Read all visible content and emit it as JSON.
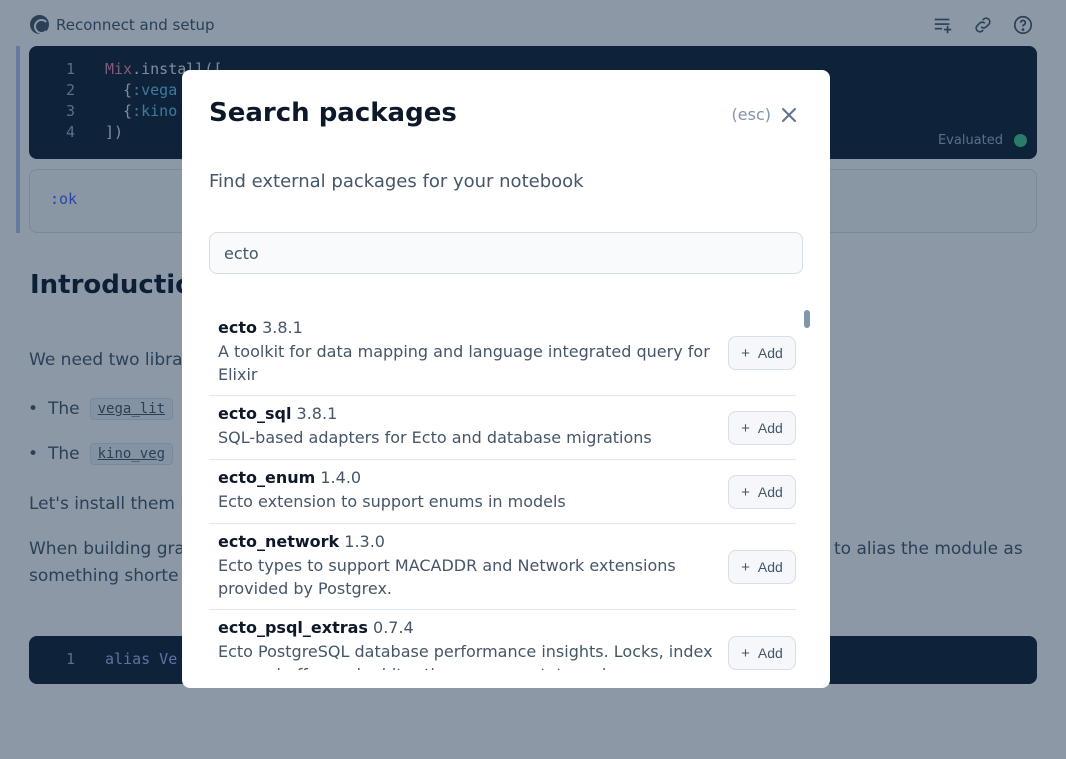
{
  "topbar": {
    "reconnect_label": "Reconnect and setup"
  },
  "notebook": {
    "setup_code": [
      {
        "ln": "1",
        "parts": [
          {
            "t": "Mix",
            "c": "mod"
          },
          {
            "t": ".install([",
            "c": ""
          }
        ]
      },
      {
        "ln": "2",
        "parts": [
          {
            "t": "  {",
            "c": ""
          },
          {
            "t": ":vega",
            "c": "atom"
          }
        ]
      },
      {
        "ln": "3",
        "parts": [
          {
            "t": "  {",
            "c": ""
          },
          {
            "t": ":kino",
            "c": "atom"
          }
        ]
      },
      {
        "ln": "4",
        "parts": [
          {
            "t": "])",
            "c": ""
          }
        ]
      }
    ],
    "evaluated_label": "Evaluated",
    "output": ":ok",
    "heading": "Introductio",
    "para1": "We need two libra",
    "bullet1_prefix": "The",
    "bullet1_code": "vega_lit",
    "bullet2_prefix": "The",
    "bullet2_code": "kino_veg",
    "para2": "Let's install them b",
    "para3_line1": "When building gra",
    "para3_right": "to alias the module as",
    "para3_line2": "something shorte",
    "alias_ln": "1",
    "alias_code": "alias Ve"
  },
  "modal": {
    "title": "Search packages",
    "esc_hint": "(esc)",
    "subtitle": "Find external packages for your notebook",
    "search_value": "ecto",
    "add_label": "Add",
    "results": [
      {
        "name": "ecto",
        "version": "3.8.1",
        "description": "A toolkit for data mapping and language integrated query for Elixir"
      },
      {
        "name": "ecto_sql",
        "version": "3.8.1",
        "description": "SQL-based adapters for Ecto and database migrations"
      },
      {
        "name": "ecto_enum",
        "version": "1.4.0",
        "description": "Ecto extension to support enums in models"
      },
      {
        "name": "ecto_network",
        "version": "1.3.0",
        "description": "Ecto types to support MACADDR and Network extensions provided by Postgrex."
      },
      {
        "name": "ecto_psql_extras",
        "version": "0.7.4",
        "description": "Ecto PostgreSQL database performance insights. Locks, index usage, buffer cache hit ratios, vacuum stats and more."
      }
    ]
  }
}
